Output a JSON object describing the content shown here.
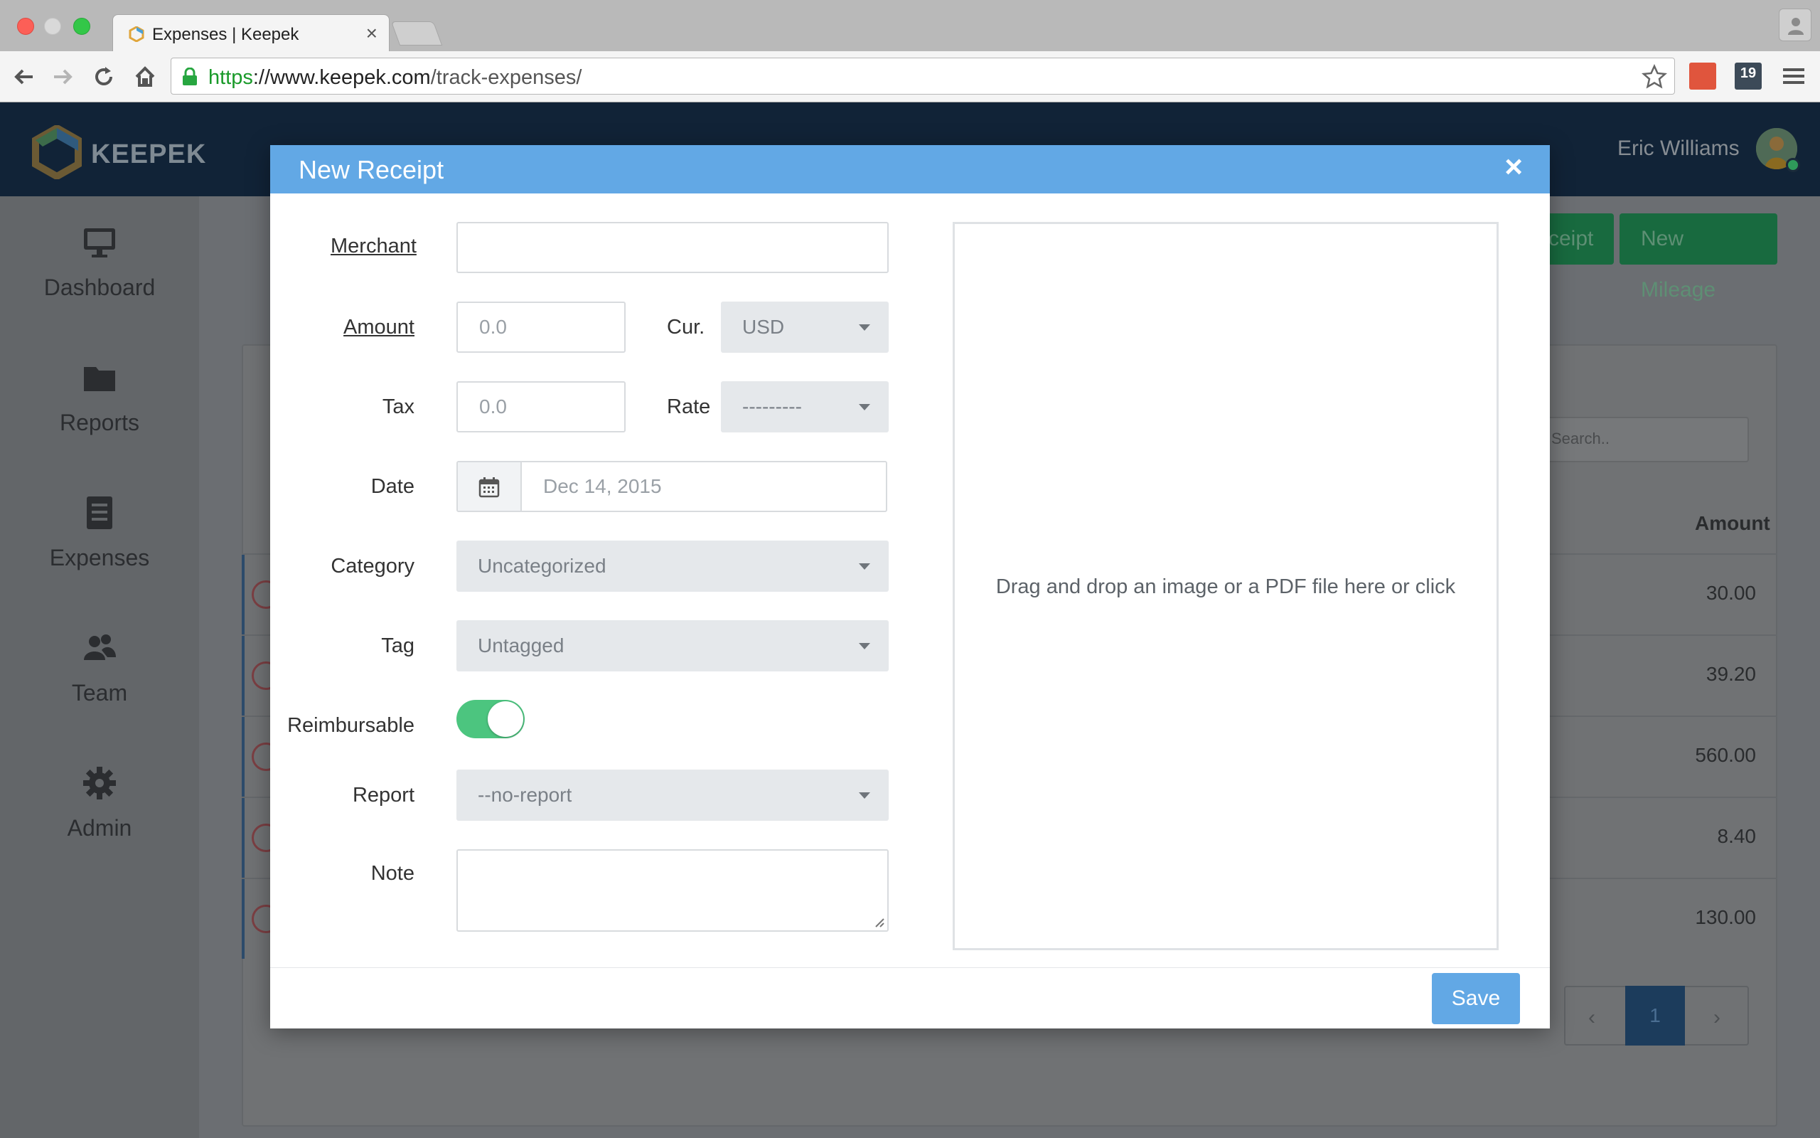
{
  "browser": {
    "tab_title": "Expenses | Keepek",
    "tab_close": "×",
    "url_scheme": "https",
    "url_host": "://www.keepek.com",
    "url_path": "/track-expenses/",
    "calendar_badge": "19"
  },
  "app": {
    "logo_text": "KEEPEK",
    "user_name": "Eric Williams",
    "sidebar": [
      {
        "label": "Dashboard",
        "icon": "monitor-icon"
      },
      {
        "label": "Reports",
        "icon": "folder-icon"
      },
      {
        "label": "Expenses",
        "icon": "document-icon"
      },
      {
        "label": "Team",
        "icon": "users-icon"
      },
      {
        "label": "Admin",
        "icon": "gear-icon"
      }
    ],
    "buttons": {
      "new_receipt_partial": "ceipt",
      "new_mileage": "New Mileage"
    },
    "search_placeholder": "Search..",
    "table": {
      "amount_header": "Amount",
      "amounts": [
        "30.00",
        "39.20",
        "560.00",
        "8.40",
        "130.00"
      ]
    },
    "pager": {
      "prev": "‹",
      "current": "1",
      "next": "›"
    }
  },
  "modal": {
    "title": "New Receipt",
    "close": "×",
    "fields": {
      "merchant_label": "Merchant",
      "merchant_value": "",
      "amount_label": "Amount",
      "amount_placeholder": "0.0",
      "currency_label": "Cur.",
      "currency_value": "USD",
      "tax_label": "Tax",
      "tax_placeholder": "0.0",
      "rate_label": "Rate",
      "rate_value": "---------",
      "date_label": "Date",
      "date_value": "Dec 14, 2015",
      "category_label": "Category",
      "category_value": "Uncategorized",
      "tag_label": "Tag",
      "tag_value": "Untagged",
      "reimbursable_label": "Reimbursable",
      "reimbursable_on": true,
      "report_label": "Report",
      "report_value": "--no-report",
      "note_label": "Note",
      "note_value": ""
    },
    "dropzone_text": "Drag and drop an image or a PDF file here or click",
    "save_label": "Save"
  },
  "colors": {
    "modal_header": "#62a8e5",
    "toggle_on": "#4cc57f",
    "app_header": "#112337",
    "url_green": "#1a9a2a"
  }
}
